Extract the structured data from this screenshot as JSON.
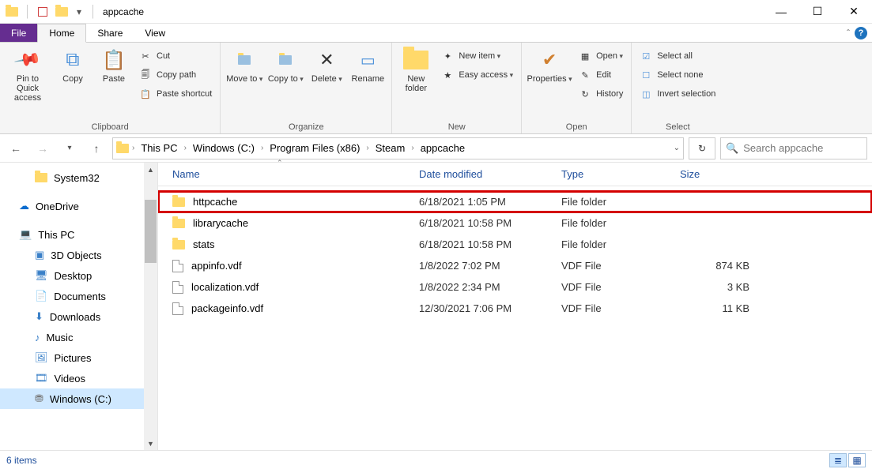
{
  "window": {
    "title": "appcache"
  },
  "tabs": {
    "file": "File",
    "home": "Home",
    "share": "Share",
    "view": "View"
  },
  "ribbon": {
    "clipboard": {
      "label": "Clipboard",
      "pin": "Pin to Quick access",
      "copy": "Copy",
      "paste": "Paste",
      "cut": "Cut",
      "copypath": "Copy path",
      "pastesc": "Paste shortcut"
    },
    "organize": {
      "label": "Organize",
      "moveto": "Move to",
      "copyto": "Copy to",
      "delete": "Delete",
      "rename": "Rename"
    },
    "new": {
      "label": "New",
      "newfolder": "New folder",
      "newitem": "New item",
      "easyaccess": "Easy access"
    },
    "open": {
      "label": "Open",
      "properties": "Properties",
      "open": "Open",
      "edit": "Edit",
      "history": "History"
    },
    "select": {
      "label": "Select",
      "selectall": "Select all",
      "selectnone": "Select none",
      "invert": "Invert selection"
    }
  },
  "breadcrumbs": [
    "This PC",
    "Windows (C:)",
    "Program Files (x86)",
    "Steam",
    "appcache"
  ],
  "search_placeholder": "Search appcache",
  "columns": {
    "name": "Name",
    "date": "Date modified",
    "type": "Type",
    "size": "Size"
  },
  "nav": {
    "system32": "System32",
    "onedrive": "OneDrive",
    "thispc": "This PC",
    "objects3d": "3D Objects",
    "desktop": "Desktop",
    "documents": "Documents",
    "downloads": "Downloads",
    "music": "Music",
    "pictures": "Pictures",
    "videos": "Videos",
    "windowsc": "Windows (C:)"
  },
  "files": [
    {
      "name": "httpcache",
      "date": "6/18/2021 1:05 PM",
      "type": "File folder",
      "size": "",
      "icon": "folder",
      "highlight": true
    },
    {
      "name": "librarycache",
      "date": "6/18/2021 10:58 PM",
      "type": "File folder",
      "size": "",
      "icon": "folder",
      "highlight": false
    },
    {
      "name": "stats",
      "date": "6/18/2021 10:58 PM",
      "type": "File folder",
      "size": "",
      "icon": "folder",
      "highlight": false
    },
    {
      "name": "appinfo.vdf",
      "date": "1/8/2022 7:02 PM",
      "type": "VDF File",
      "size": "874 KB",
      "icon": "file",
      "highlight": false
    },
    {
      "name": "localization.vdf",
      "date": "1/8/2022 2:34 PM",
      "type": "VDF File",
      "size": "3 KB",
      "icon": "file",
      "highlight": false
    },
    {
      "name": "packageinfo.vdf",
      "date": "12/30/2021 7:06 PM",
      "type": "VDF File",
      "size": "11 KB",
      "icon": "file",
      "highlight": false
    }
  ],
  "status": {
    "count": "6 items"
  }
}
